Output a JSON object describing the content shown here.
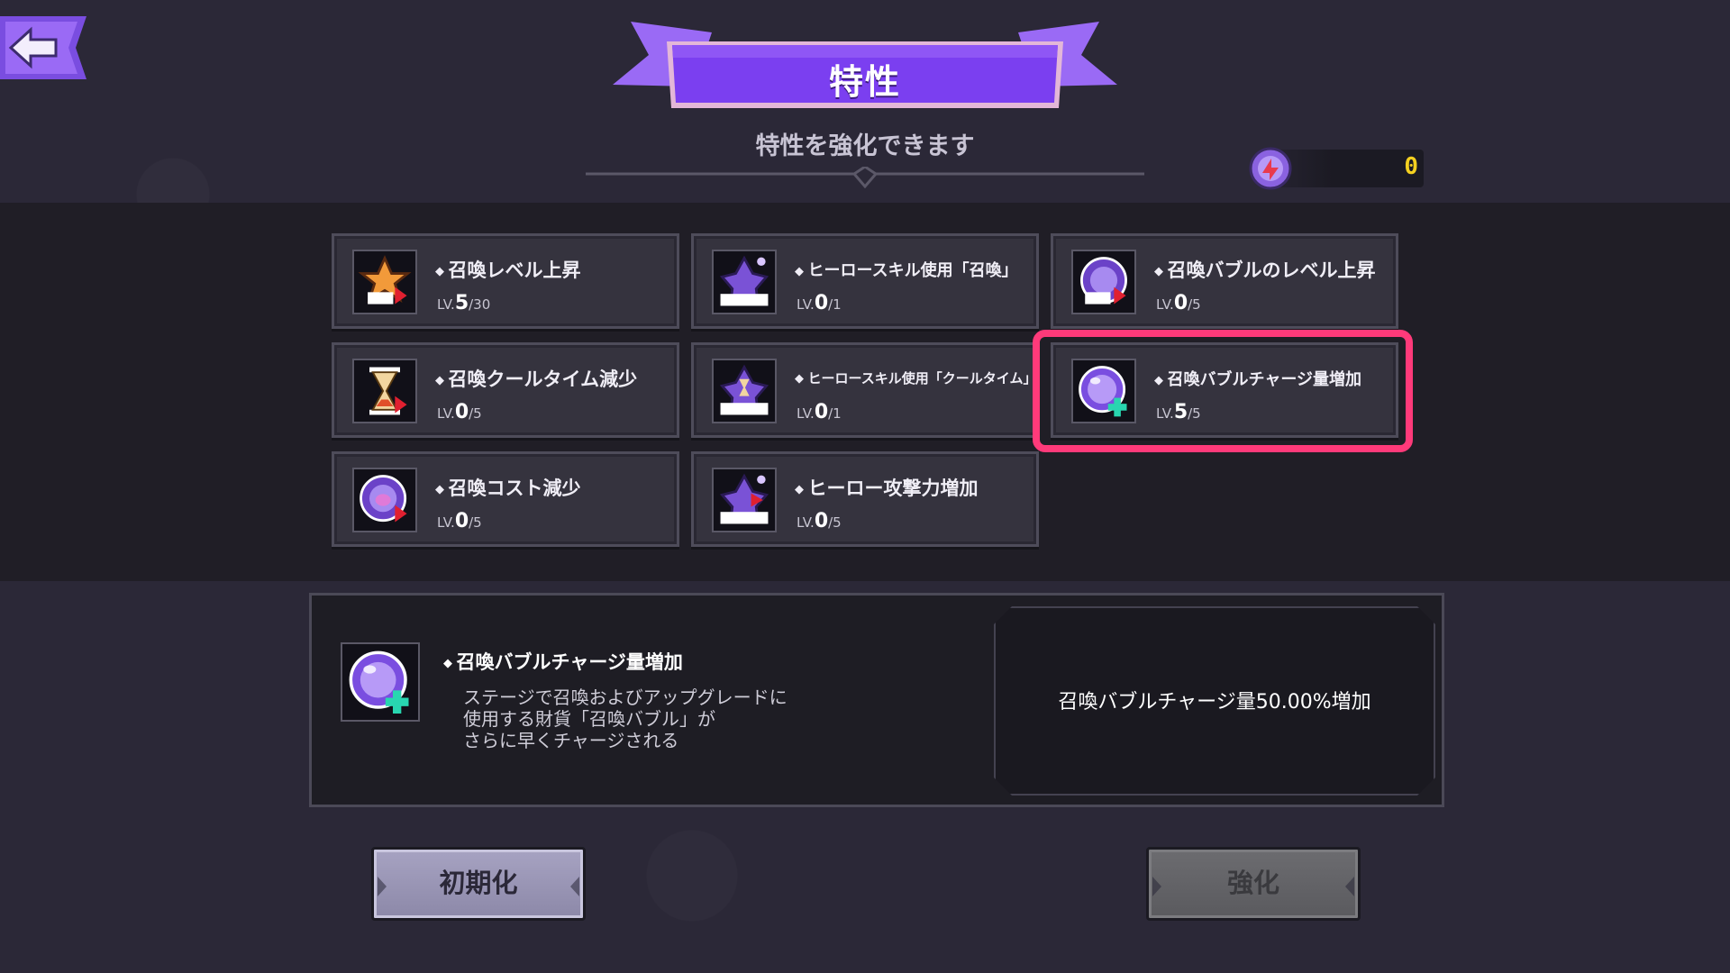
{
  "header": {
    "title": "特性",
    "subtitle": "特性を強化できます",
    "currency_value": "0"
  },
  "traits": [
    {
      "name": "召喚レベル上昇",
      "lv_prefix": "LV.",
      "level": "5",
      "max": "/30",
      "icon": "star-lv-up-icon"
    },
    {
      "name": "ヒーロースキル使用「召喚」",
      "lv_prefix": "LV.",
      "level": "0",
      "max": "/1",
      "icon": "hero-skill-icon"
    },
    {
      "name": "召喚バブルのレベル上昇",
      "lv_prefix": "LV.",
      "level": "0",
      "max": "/5",
      "icon": "bubble-lv-up-icon"
    },
    {
      "name": "召喚クールタイム減少",
      "lv_prefix": "LV.",
      "level": "0",
      "max": "/5",
      "icon": "hourglass-down-icon"
    },
    {
      "name": "ヒーロースキル使用「クールタイム」",
      "lv_prefix": "LV.",
      "level": "0",
      "max": "/1",
      "icon": "hero-skill-hourglass-icon"
    },
    {
      "name": "召喚バブルチャージ量増加",
      "lv_prefix": "LV.",
      "level": "5",
      "max": "/5",
      "icon": "bubble-plus-icon"
    },
    {
      "name": "召喚コスト減少",
      "lv_prefix": "LV.",
      "level": "0",
      "max": "/5",
      "icon": "bubble-cost-down-icon"
    },
    {
      "name": "ヒーロー攻撃力増加",
      "lv_prefix": "LV.",
      "level": "0",
      "max": "/5",
      "icon": "hero-skill-attack-up-icon"
    }
  ],
  "detail": {
    "name": "召喚バブルチャージ量増加",
    "description": "ステージで召喚およびアップグレードに\n使用する財貨「召喚バブル」が\nさらに早くチャージされる",
    "effect": "召喚バブルチャージ量50.00%増加"
  },
  "buttons": {
    "reset_label": "初期化",
    "upgrade_label": "強化"
  },
  "colors": {
    "banner_purple": "#7b3ff0",
    "highlight_pink": "#ff3a7a",
    "currency_yellow": "#f4d020"
  }
}
